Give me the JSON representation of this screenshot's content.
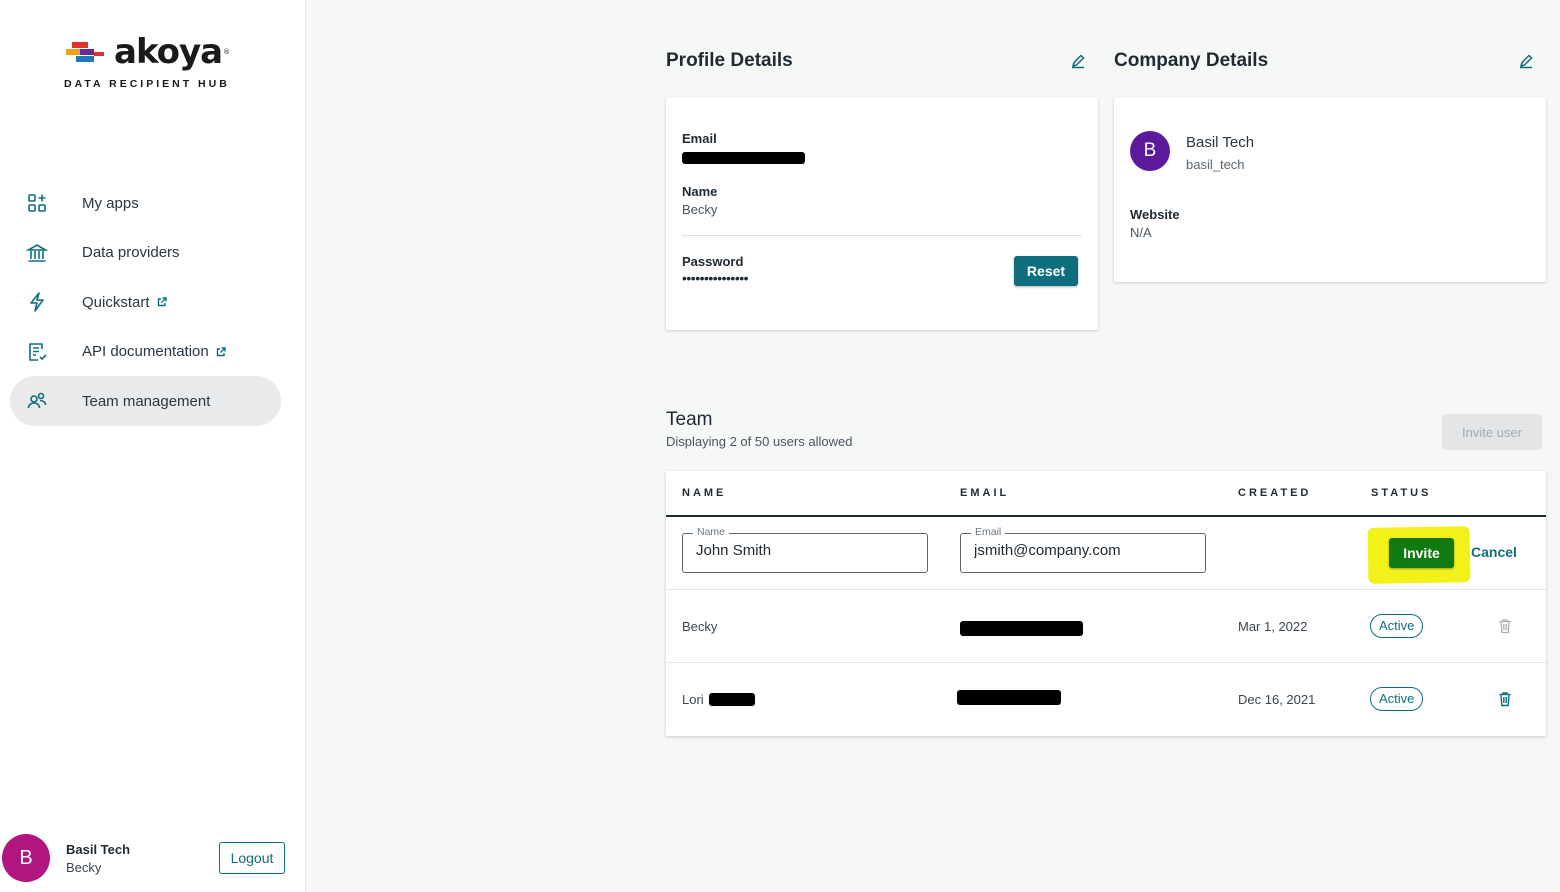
{
  "brand": {
    "name": "akoya",
    "subtitle": "DATA RECIPIENT HUB"
  },
  "sidebar": {
    "items": [
      {
        "label": "My apps",
        "icon": "apps-icon",
        "external": false,
        "active": false
      },
      {
        "label": "Data providers",
        "icon": "bank-icon",
        "external": false,
        "active": false
      },
      {
        "label": "Quickstart",
        "icon": "lightning-icon",
        "external": true,
        "active": false
      },
      {
        "label": "API documentation",
        "icon": "document-icon",
        "external": true,
        "active": false
      },
      {
        "label": "Team management",
        "icon": "team-icon",
        "external": false,
        "active": true
      }
    ],
    "user": {
      "initial": "B",
      "company": "Basil Tech",
      "name": "Becky",
      "logout_label": "Logout"
    }
  },
  "profile": {
    "title": "Profile Details",
    "email_label": "Email",
    "name_label": "Name",
    "name_value": "Becky",
    "password_label": "Password",
    "password_value": "•••••••••••••••",
    "reset_label": "Reset"
  },
  "company": {
    "title": "Company Details",
    "initial": "B",
    "name": "Basil Tech",
    "handle": "basil_tech",
    "website_label": "Website",
    "website_value": "N/A"
  },
  "team": {
    "title": "Team",
    "subtitle": "Displaying 2 of 50 users allowed",
    "invite_user_label": "Invite user",
    "columns": [
      "NAME",
      "EMAIL",
      "CREATED",
      "STATUS"
    ],
    "new_row": {
      "name_legend": "Name",
      "name_value": "John Smith",
      "email_legend": "Email",
      "email_value": "jsmith@company.com",
      "invite_label": "Invite",
      "cancel_label": "Cancel"
    },
    "rows": [
      {
        "name": "Becky",
        "created": "Mar 1, 2022",
        "status": "Active"
      },
      {
        "name": "Lori",
        "created": "Dec 16, 2021",
        "status": "Active"
      }
    ]
  },
  "colors": {
    "accent": "#0e6e7d",
    "invite_green": "#127a12",
    "highlight": "#f2f21a",
    "avatar_user": "#b01580",
    "avatar_company": "#5a1a9a"
  }
}
